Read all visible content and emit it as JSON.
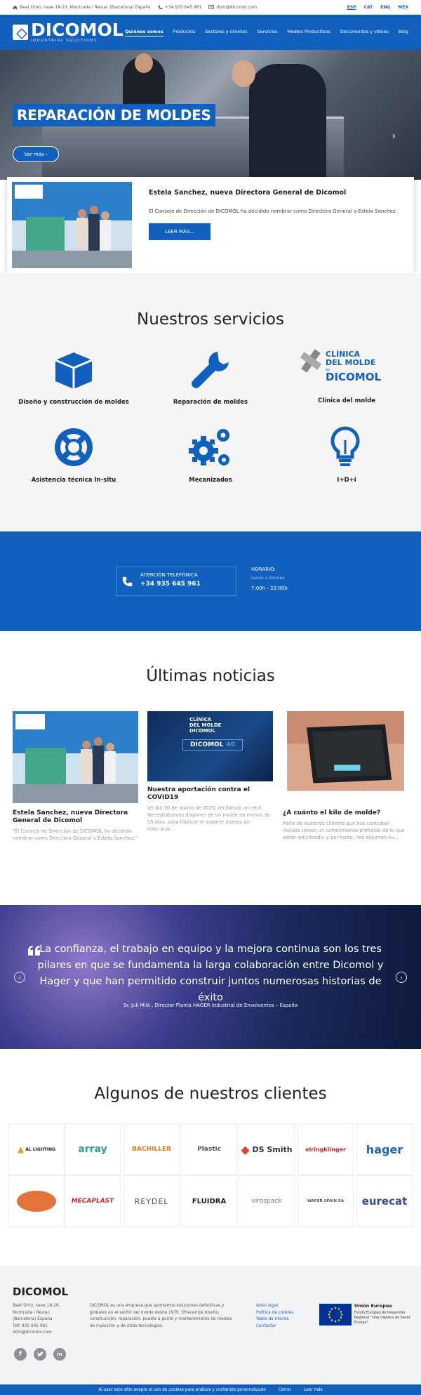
{
  "topbar": {
    "address": "Beat Oriol, nave 18-19. Montcada i Reixac (Barcelona) España",
    "phone": "+34 935 645 961",
    "email": "dom@dicomol.com",
    "languages": [
      "ESP",
      "CAT",
      "ENG",
      "MEX"
    ]
  },
  "brand": {
    "name": "DICOMOL",
    "tagline": "INDUSTRIAL SOLUTIONS"
  },
  "menu": [
    "Quiénes somos",
    "Productos",
    "Sectores y clientes",
    "Servicios",
    "Medios Productivos",
    "Documentos y vídeos",
    "Blog"
  ],
  "hero": {
    "title": "REPARACIÓN DE MOLDES",
    "button": "Ver más"
  },
  "featured": {
    "title": "Estela Sanchez, nueva Directora General de Dicomol",
    "text": "El Consejo de Dirección de DICOMOL ha decidido nombrar como Directora General a Estela Sanchez.",
    "button": "LEER MÁS..."
  },
  "services": {
    "title": "Nuestros servicios",
    "items": [
      {
        "label": "Diseño y construcción de moldes",
        "icon": "cube-icon"
      },
      {
        "label": "Reparación de moldes",
        "icon": "wrench-icon"
      },
      {
        "label": "Clínica del molde",
        "icon": "clinica-logo"
      },
      {
        "label": "Asistencia técnica In-situ",
        "icon": "lifebuoy-icon"
      },
      {
        "label": "Mecanizados",
        "icon": "gears-icon"
      },
      {
        "label": "I+D+i",
        "icon": "lightbulb-icon"
      }
    ],
    "clinica_logo": {
      "line1": "CLÍNICA",
      "line2": "DEL MOLDE",
      "by": "by",
      "brand": "DICOMOL"
    }
  },
  "contact": {
    "phone_label": "ATENCIÓN TELEFÓNICA",
    "phone": "+34 935 645 961",
    "hours_label": "HORARIO:",
    "days": "Lunes a Viernes",
    "hours": "7:00h - 22:00h"
  },
  "news": {
    "title": "Últimas noticias",
    "items": [
      {
        "title": "Estela Sanchez, nueva Directora General de Dicomol",
        "excerpt": "\"El Consejo de Dirección de DICOMOL ha decidido nombrar como Directora General a Estela Sanchez.\""
      },
      {
        "title": "Nuestra aportación contra el COVID19",
        "excerpt": "¡El día 30 de marzo de 2020, recibimos un reto! Necesitábamos disponer de un molde en menos de 15 días, para fabricar el soporte viseras de máscaras..."
      },
      {
        "title": "¿A cuánto el kilo de molde?",
        "excerpt": "Parte de nuestros clientes que nos contratan moldes tienen un conocimiento profundo de lo que están solicitando, y por tanto, nos adjuntan su..."
      }
    ],
    "covid_img": {
      "line1": "CLÍNICA",
      "line2": "DEL MOLDE",
      "brand": "DICOMOL",
      "badge": "40"
    }
  },
  "testimonial": {
    "quote": "La confianza, el trabajo en equipo y la mejora continua son los tres pilares en que se fundamenta la larga colaboración entre Dicomol y Hager y que han permitido construir juntos numerosas historias de éxito",
    "author": "Sr. Juli Milà , Director Planta HAGER Industrial de Envolventes – España"
  },
  "clients": {
    "title": "Algunos de nuestros clientes",
    "row1": [
      "AL LIGHTING",
      "array",
      "BACHILLER",
      "Plastic",
      "DS Smith",
      "elringklinger",
      "hager"
    ],
    "row2": [
      "",
      "MECAPLAST",
      "REYDEL",
      "FLUIDRA",
      "virospack",
      "WAFER SPAIN SA",
      "eurecat"
    ],
    "colors": {
      "hager": "#1f66c2",
      "eurecat": "#3b4d9e",
      "bachiller": "#e07b1a",
      "mecaplast": "#d81e2c",
      "dssmith": "#e8412c"
    }
  },
  "footer": {
    "logo": "DICOMOL",
    "address": "Beat Oriol, nave 18-19,\nMontcada i Reixac\n(Barcelona) España\nTelf. 935 645 961\ndom@dicomol.com",
    "about": "DICOMOL es una empresa que aportamos soluciones definitivas y globales en el sector del molde desde 1979. Ofrecemos diseño, construcción, reparación, puesta a punto y mantenimiento de moldes de inyección y de otras tecnologías.",
    "links": [
      "Aviso legal",
      "Política de cookies",
      "Webs de interés",
      "Contactar"
    ],
    "eu_title": "Unión Europea",
    "eu_text": "Fondo Europeo de Desarrollo Regional \"Una manera de hacer Europa\""
  },
  "cookie": {
    "text": "Al usar este sitio acepta el uso de cookies para análisis y contenido personalizado",
    "close": "Cerrar",
    "more": "Leer más"
  },
  "colors": {
    "primary": "#1160bd",
    "gray_bg": "#f5f5f6",
    "footer_bg": "#f1f3f5"
  }
}
